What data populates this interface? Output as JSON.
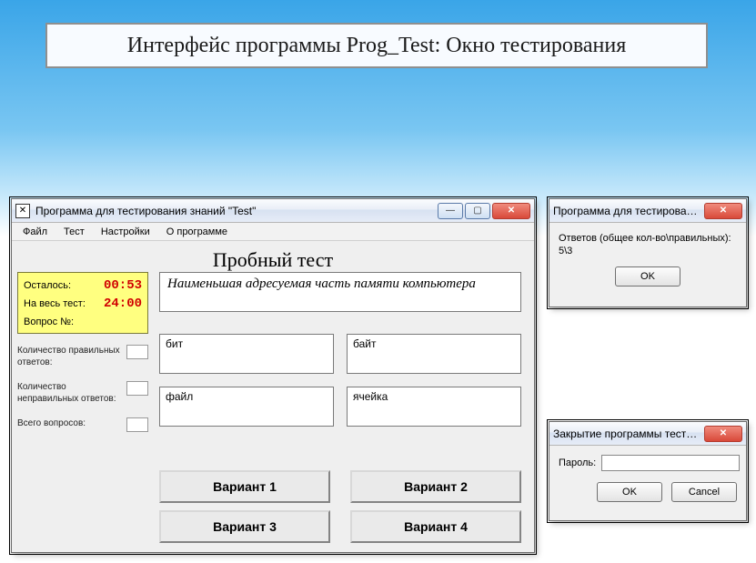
{
  "slide": {
    "title": "Интерфейс программы Prog_Test: Окно тестирования"
  },
  "main_window": {
    "title": "Программа для тестирования знаний \"Test\"",
    "menu": {
      "file": "Файл",
      "test": "Тест",
      "settings": "Настройки",
      "about": "О программе"
    },
    "heading": "Пробный тест",
    "timer": {
      "remaining_label": "Осталось:",
      "remaining_value": "00:53",
      "total_label": "На весь тест:",
      "total_value": "24:00",
      "question_no_label": "Вопрос №:",
      "question_no_value": ""
    },
    "stats": {
      "correct_label": "Количество правильных ответов:",
      "correct_value": "",
      "wrong_label": "Количество неправильных ответов:",
      "wrong_value": "",
      "total_label": "Всего вопросов:",
      "total_value": ""
    },
    "question": "Наименьшая адресуемая часть памяти компьютера",
    "answers": {
      "a1": "бит",
      "a2": "байт",
      "a3": "файл",
      "a4": "ячейка"
    },
    "variants": {
      "v1": "Вариант 1",
      "v2": "Вариант 2",
      "v3": "Вариант 3",
      "v4": "Вариант 4"
    }
  },
  "results_dialog": {
    "title": "Программа для тестирования з...",
    "message_line1": "Ответов (общее кол-во\\правильных):",
    "message_line2": "5\\3",
    "ok": "OK"
  },
  "close_dialog": {
    "title": "Закрытие программы тестиров...",
    "password_label": "Пароль:",
    "password_value": "",
    "ok": "OK",
    "cancel": "Cancel"
  }
}
